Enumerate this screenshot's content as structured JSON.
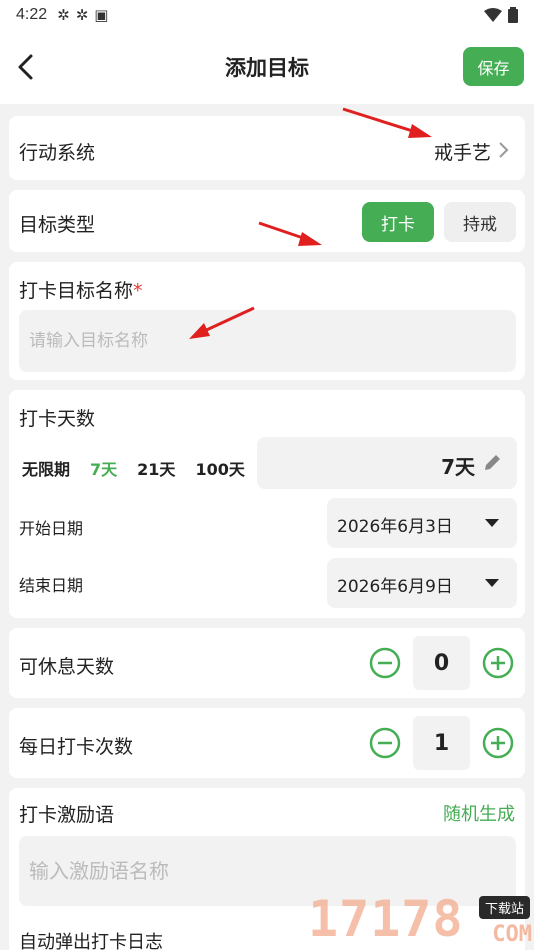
{
  "status_bar": {
    "time": "4:22"
  },
  "nav": {
    "title": "添加目标",
    "save_label": "保存"
  },
  "action_system": {
    "label": "行动系统",
    "value": "戒手艺"
  },
  "goal_type": {
    "label": "目标类型",
    "options": [
      "打卡",
      "持戒"
    ],
    "selected": "打卡"
  },
  "goal_name": {
    "label": "打卡目标名称",
    "required_mark": "*",
    "placeholder": "请输入目标名称"
  },
  "days": {
    "label": "打卡天数",
    "options": [
      "无限期",
      "7天",
      "21天",
      "100天"
    ],
    "selected": "7天",
    "value": "7天",
    "start_label": "开始日期",
    "start_value": "2026年6月3日",
    "end_label": "结束日期",
    "end_value": "2026年6月9日"
  },
  "rest_days": {
    "label": "可休息天数",
    "value": "0"
  },
  "daily_times": {
    "label": "每日打卡次数",
    "value": "1"
  },
  "motto": {
    "label": "打卡激励语",
    "generate_label": "随机生成",
    "placeholder": "输入激励语名称"
  },
  "auto_log": {
    "label": "自动弹出打卡日志"
  },
  "watermark": {
    "digits": "17178",
    "badge": "下载站",
    "domain": "COM"
  },
  "colors": {
    "accent": "#45ad54",
    "required": "#e53935",
    "annotation_arrow": "#e0201f"
  }
}
